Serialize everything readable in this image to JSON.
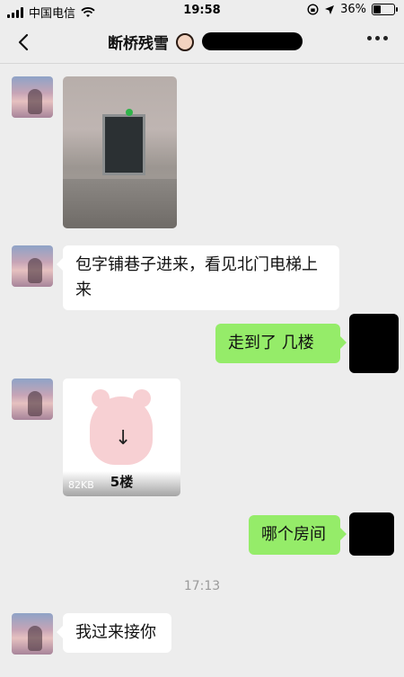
{
  "status_bar": {
    "carrier": "中国电信",
    "time": "19:58",
    "battery": "36%"
  },
  "nav": {
    "title": "断桥残雪"
  },
  "messages": [
    {
      "sender": "other",
      "type": "image"
    },
    {
      "sender": "other",
      "type": "text",
      "text": "包字铺巷子进来，看见北门电梯上来"
    },
    {
      "sender": "me",
      "type": "text",
      "text": "走到了   几楼"
    },
    {
      "sender": "other",
      "type": "sticker",
      "caption": "5楼",
      "size": "82KB"
    },
    {
      "sender": "me",
      "type": "text",
      "text": "哪个房间"
    },
    {
      "type": "timestamp",
      "text": "17:13"
    },
    {
      "sender": "other",
      "type": "text",
      "text": "我过来接你"
    }
  ],
  "icons": {
    "back": "chevron-left-icon",
    "more": "ellipsis-icon",
    "signal": "signal-icon",
    "wifi": "wifi-icon",
    "lock": "orientation-lock-icon",
    "location": "location-arrow-icon",
    "battery": "battery-icon"
  }
}
